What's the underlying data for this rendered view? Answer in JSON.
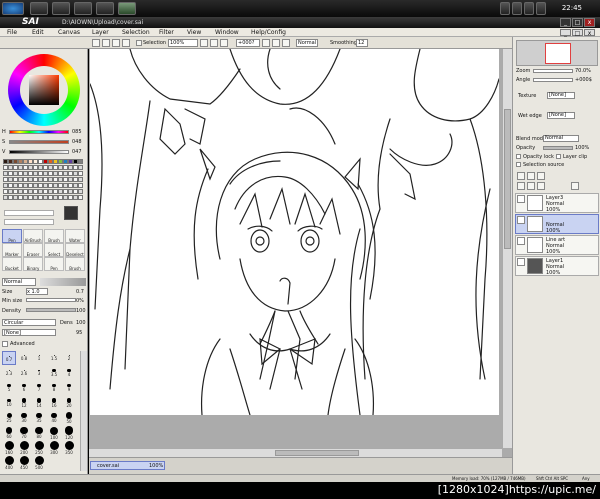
{
  "taskbar": {
    "clock": "22:45"
  },
  "window": {
    "logo": "SAI",
    "title": "D:\\AIOWN\\Upload\\cover.sai",
    "minimize": "_",
    "maximize": "□",
    "close": "x"
  },
  "menu": [
    "File",
    "Edit",
    "Canvas",
    "Layer",
    "Selection",
    "Filter",
    "View",
    "Window",
    "Help/Config"
  ],
  "toolbar": {
    "selection_label": "Selection",
    "zoom": "100%",
    "rotation": "+000?",
    "blend": "Normal",
    "smoothing_label": "Smoothing",
    "smoothing": "12"
  },
  "color": {
    "h_label": "H",
    "h_value": "085",
    "s_label": "S",
    "s_value": "048",
    "v_label": "V",
    "v_value": "047",
    "current": "#333333",
    "swatches": [
      "#2b1a12",
      "#4a2a1c",
      "#7a4a30",
      "#b08060",
      "#d8b090",
      "#ffe0c8",
      "#fff0e0",
      "#ffffff",
      "#c00000",
      "#e06020",
      "#f0c020",
      "#80c040",
      "#2080c0",
      "#6040a0",
      "#000000",
      "#808080"
    ]
  },
  "tools": [
    {
      "name": "Pen",
      "selected": true
    },
    {
      "name": "AirBrush",
      "selected": false
    },
    {
      "name": "Brush",
      "selected": false
    },
    {
      "name": "Water",
      "selected": false
    },
    {
      "name": "Marker",
      "selected": false
    },
    {
      "name": "Eraser",
      "selected": false
    },
    {
      "name": "Select",
      "selected": false
    },
    {
      "name": "Deselect",
      "selected": false
    },
    {
      "name": "Bucket",
      "selected": false
    },
    {
      "name": "Binary",
      "selected": false
    },
    {
      "name": "Pen",
      "selected": false
    },
    {
      "name": "Brush",
      "selected": false
    }
  ],
  "brush": {
    "mode": "Normal",
    "size_label": "Size",
    "size_mult": "x 1.0",
    "size_value": "0.7",
    "min_size_label": "Min size",
    "min_size_value": "0%",
    "density_label": "Density",
    "density_value": "100",
    "shape": "Circular",
    "shape_value": "Dens",
    "shape_pct": "100",
    "texture": "[None]",
    "texture_value": "95",
    "advanced_label": "Advanced",
    "sizes": [
      "0.7",
      "0.8",
      "1",
      "1.5",
      "2",
      "2.3",
      "2.6",
      "3",
      "3.5",
      "4",
      "5",
      "6",
      "7",
      "8",
      "9",
      "10",
      "12",
      "14",
      "16",
      "20",
      "25",
      "30",
      "35",
      "40",
      "50",
      "60",
      "70",
      "80",
      "100",
      "120",
      "160",
      "200",
      "250",
      "300",
      "350",
      "400",
      "450",
      "500"
    ]
  },
  "navigator": {
    "zoom_label": "Zoom",
    "zoom_value": "70.0%",
    "angle_label": "Angle",
    "angle_value": "+000$"
  },
  "layer_props": {
    "texture_label": "Texture",
    "texture_value": "[None]",
    "wet_edge_label": "Wet edge",
    "wet_edge_value": "[None]",
    "blend_label": "Blend mode",
    "blend_value": "Normal",
    "opacity_label": "Opacity",
    "opacity_value": "100%",
    "opacity_lock": "Opacity lock",
    "layer_clip": "Layer clip",
    "selection_source": "Selection source"
  },
  "layers": [
    {
      "name": "Layer3",
      "mode": "Normal",
      "opacity": "100%",
      "selected": false
    },
    {
      "name": "",
      "mode": "Normal",
      "opacity": "100%",
      "selected": true
    },
    {
      "name": "Line art",
      "mode": "Normal",
      "opacity": "100%",
      "selected": false
    },
    {
      "name": "Layer1",
      "mode": "Normal",
      "opacity": "100%",
      "selected": false
    }
  ],
  "doc_tab": {
    "name": "cover.sai",
    "zoom": "100%"
  },
  "status": {
    "memory": "Memory load: 70% (127MB / 746MB)",
    "keys": "Shft Ctrl Alt SPC",
    "lock": "Any"
  },
  "watermark": "[1280x1024]https://upic.me/"
}
